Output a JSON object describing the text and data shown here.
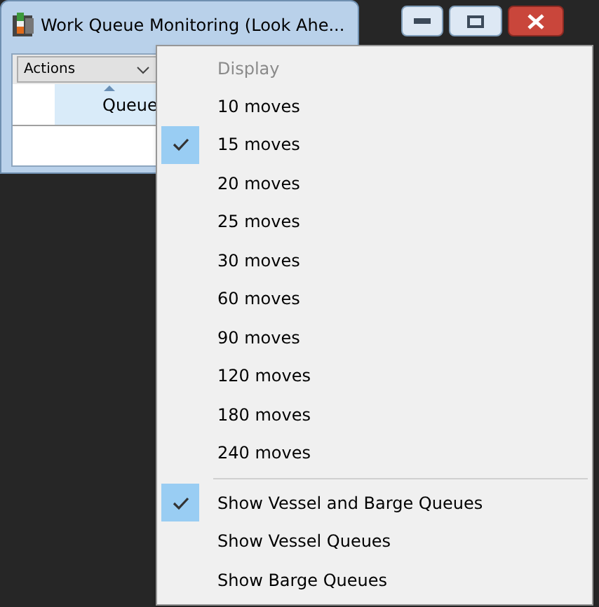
{
  "window": {
    "title": "Work Queue Monitoring (Look Ahe..."
  },
  "toolbar": {
    "actions_dropdown": {
      "label": "Actions"
    }
  },
  "grid": {
    "columns": [
      {
        "label": "Queue",
        "sorted": true
      }
    ]
  },
  "menu": {
    "header": "Display",
    "items": [
      {
        "kind": "item",
        "label": "10 moves",
        "selected": false
      },
      {
        "kind": "item",
        "label": "15 moves",
        "selected": true
      },
      {
        "kind": "item",
        "label": "20 moves",
        "selected": false
      },
      {
        "kind": "item",
        "label": "25 moves",
        "selected": false
      },
      {
        "kind": "item",
        "label": "30 moves",
        "selected": false
      },
      {
        "kind": "item",
        "label": "60 moves",
        "selected": false
      },
      {
        "kind": "item",
        "label": "90 moves",
        "selected": false
      },
      {
        "kind": "item",
        "label": "120 moves",
        "selected": false
      },
      {
        "kind": "item",
        "label": "180 moves",
        "selected": false
      },
      {
        "kind": "item",
        "label": "240 moves",
        "selected": false
      },
      {
        "kind": "separator"
      },
      {
        "kind": "item",
        "label": "Show Vessel and Barge Queues",
        "selected": true
      },
      {
        "kind": "item",
        "label": "Show Vessel Queues",
        "selected": false
      },
      {
        "kind": "item",
        "label": "Show Barge Queues",
        "selected": false
      }
    ]
  }
}
